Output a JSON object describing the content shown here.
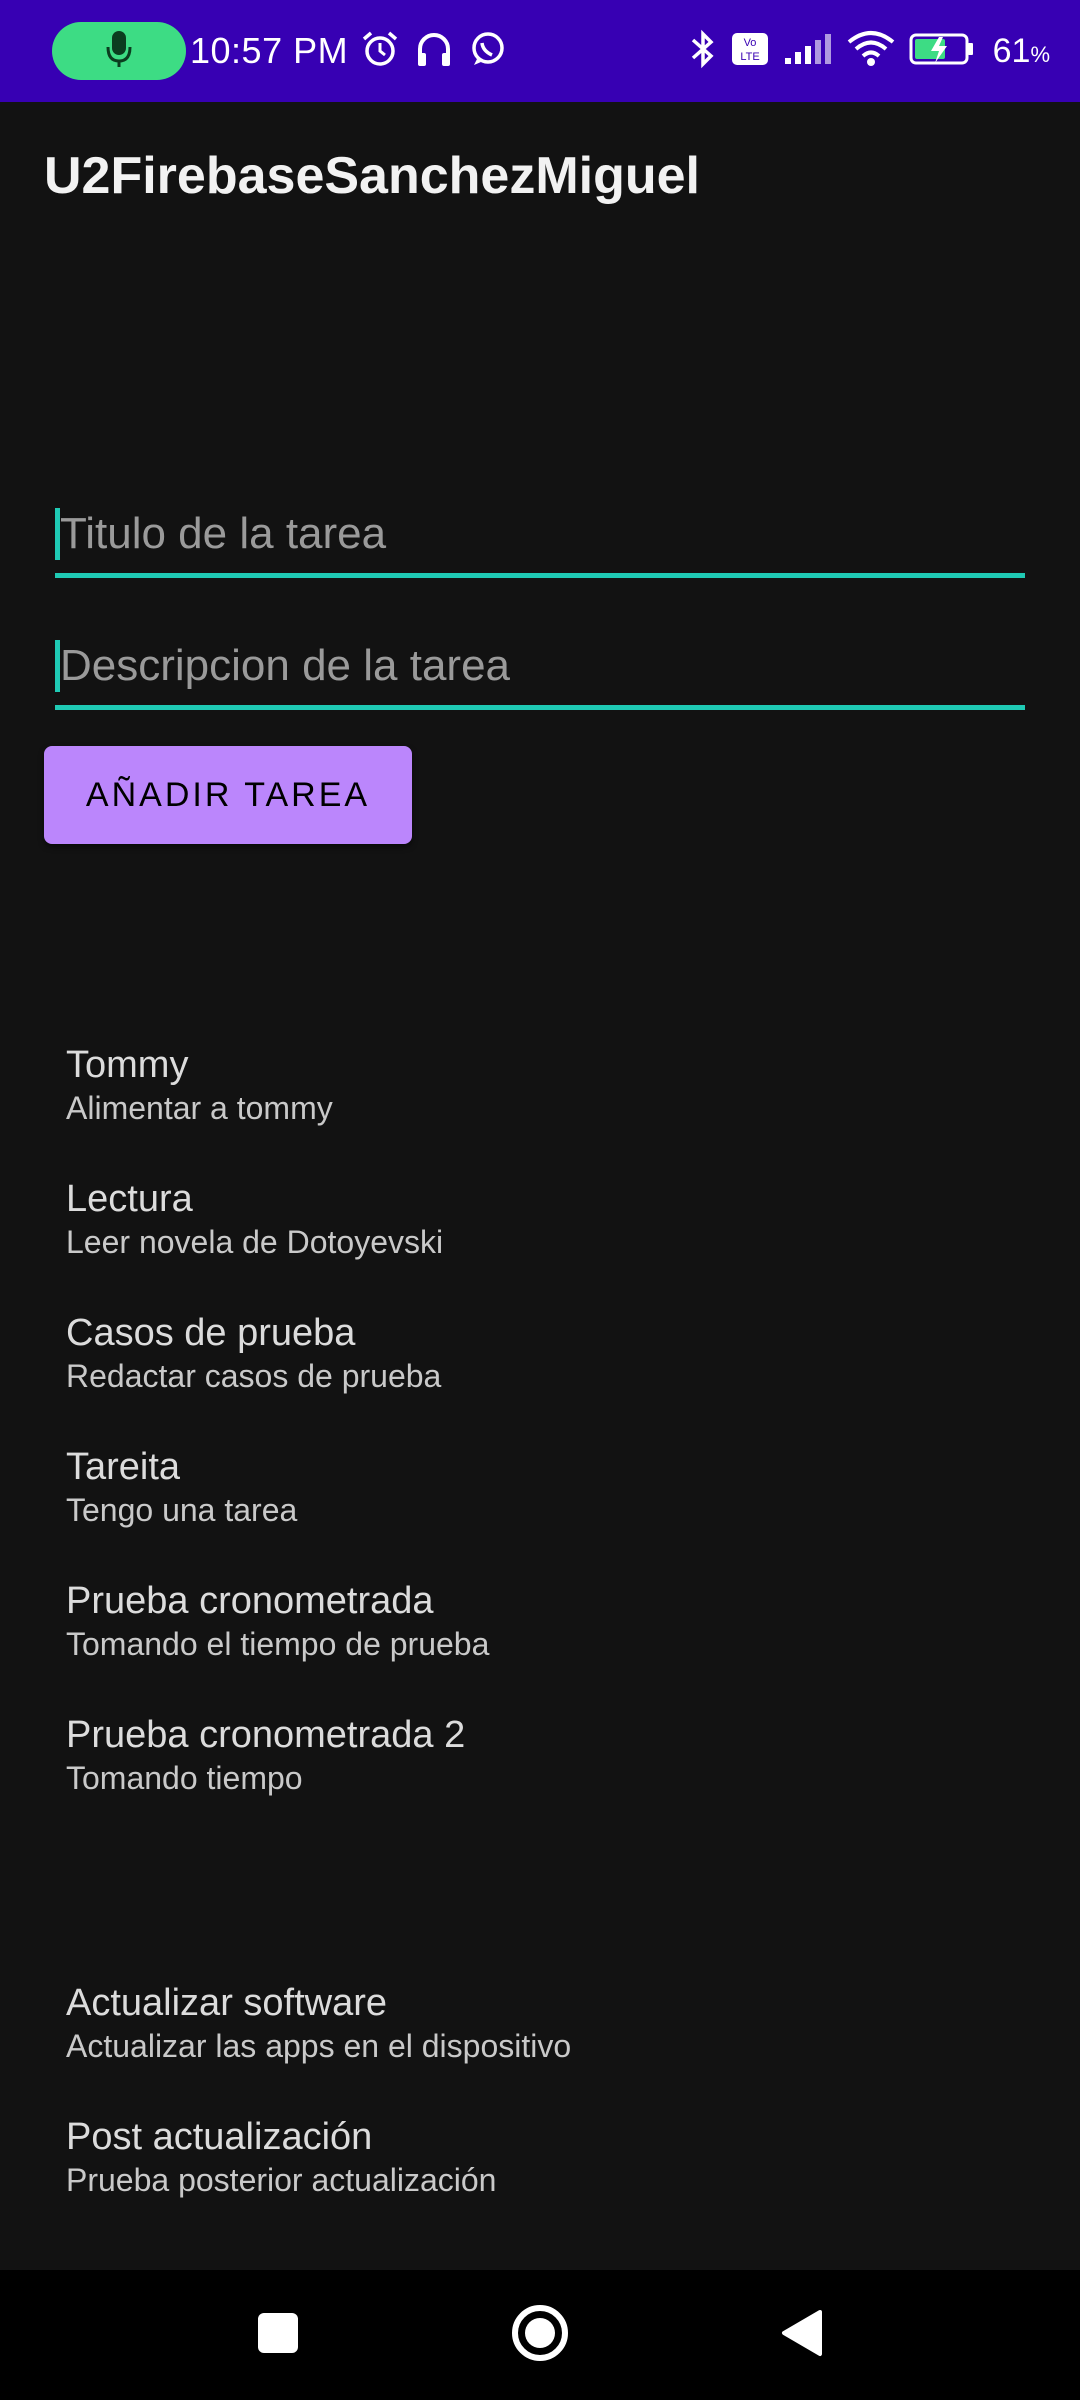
{
  "status_bar": {
    "time": "10:57 PM",
    "battery_percent": "61",
    "battery_unit": "%",
    "icons_left": [
      "mic-icon",
      "alarm-icon",
      "headphones-icon",
      "whatsapp-icon"
    ],
    "icons_right": [
      "bluetooth-icon",
      "volte-icon",
      "signal-icon",
      "wifi-icon",
      "battery-charging-icon"
    ],
    "colors": {
      "background": "#3700b3",
      "mic_pill": "#3ddc84"
    }
  },
  "app": {
    "title": "U2FirebaseSanchezMiguel"
  },
  "form": {
    "title_placeholder": "Titulo de la tarea",
    "title_value": "",
    "description_placeholder": "Descripcion de la tarea",
    "description_value": "",
    "add_button_label": "AÑADIR TAREA",
    "colors": {
      "accent": "#1fcab4",
      "button": "#bb86fc"
    }
  },
  "tasks": [
    {
      "title": "Tommy",
      "description": "Alimentar a tommy"
    },
    {
      "title": "Lectura",
      "description": "Leer novela de Dotoyevski"
    },
    {
      "title": "Casos de prueba",
      "description": "Redactar casos de prueba"
    },
    {
      "title": "Tareita",
      "description": "Tengo una tarea"
    },
    {
      "title": "Prueba cronometrada",
      "description": "Tomando el tiempo de prueba"
    },
    {
      "title": "Prueba cronometrada 2",
      "description": "Tomando tiempo"
    },
    {
      "title": "Actualizar software",
      "description": "Actualizar las apps en el dispositivo"
    },
    {
      "title": "Post actualización",
      "description": "Prueba posterior actualización"
    }
  ],
  "nav_bar": {
    "buttons": [
      "recents-square-icon",
      "home-circle-icon",
      "back-triangle-icon"
    ]
  }
}
